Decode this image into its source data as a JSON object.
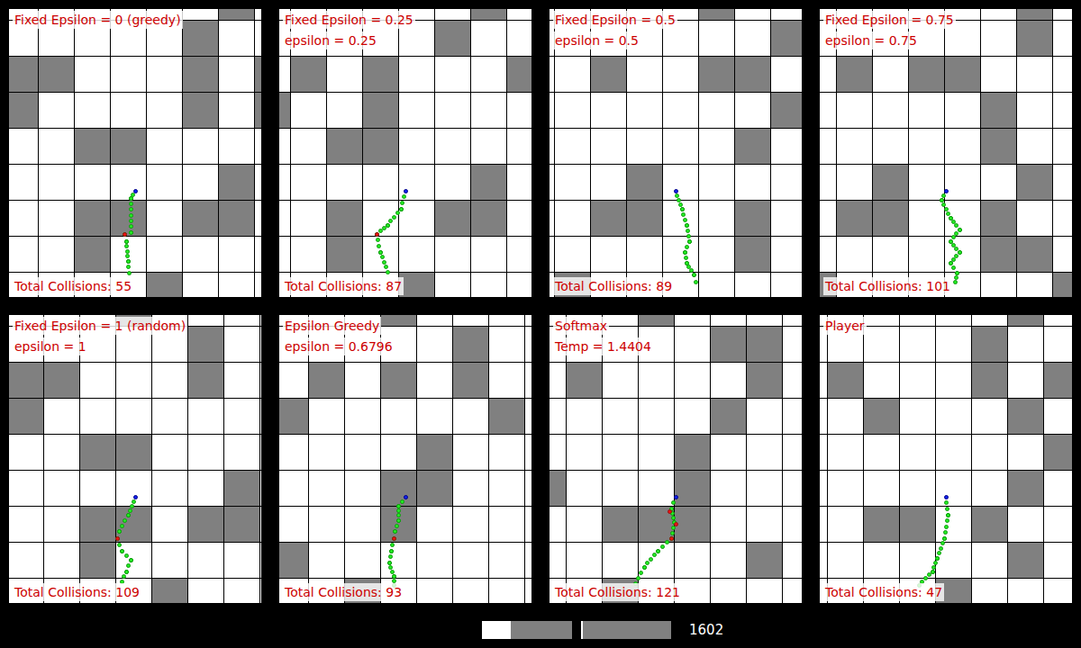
{
  "panels": [
    {
      "title": "Fixed Epsilon = 0 (greedy)",
      "param": null,
      "collisions": "Total Collisions: 55",
      "grid": {
        "offset": [
          -8,
          -28
        ],
        "blocked": [
          [
            6,
            0
          ],
          [
            5,
            1
          ],
          [
            0,
            2
          ],
          [
            1,
            2
          ],
          [
            5,
            2
          ],
          [
            7,
            2
          ],
          [
            0,
            3
          ],
          [
            5,
            3
          ],
          [
            7,
            3
          ],
          [
            2,
            4
          ],
          [
            3,
            4
          ],
          [
            6,
            5
          ],
          [
            2,
            6
          ],
          [
            3,
            6
          ],
          [
            5,
            6
          ],
          [
            6,
            6
          ],
          [
            2,
            7
          ],
          [
            4,
            8
          ]
        ]
      },
      "start": [
        140,
        202
      ],
      "path": [
        [
          140,
          202
        ],
        [
          135,
          210
        ],
        [
          135,
          248
        ],
        [
          128,
          250
        ],
        [
          130,
          258
        ],
        [
          132,
          280
        ],
        [
          133,
          293
        ]
      ],
      "hits": [
        [
          128,
          250
        ]
      ]
    },
    {
      "title": "Fixed Epsilon = 0.25",
      "param": "epsilon = 0.25",
      "collisions": "Total Collisions: 87",
      "grid": {
        "offset": [
          -28,
          -28
        ],
        "blocked": [
          [
            6,
            0
          ],
          [
            5,
            1
          ],
          [
            1,
            2
          ],
          [
            3,
            2
          ],
          [
            7,
            2
          ],
          [
            0,
            3
          ],
          [
            3,
            3
          ],
          [
            2,
            4
          ],
          [
            3,
            4
          ],
          [
            6,
            5
          ],
          [
            2,
            6
          ],
          [
            5,
            6
          ],
          [
            6,
            6
          ],
          [
            2,
            7
          ],
          [
            4,
            8
          ]
        ]
      },
      "start": [
        140,
        202
      ],
      "path": [
        [
          140,
          202
        ],
        [
          135,
          222
        ],
        [
          120,
          240
        ],
        [
          108,
          250
        ],
        [
          112,
          270
        ],
        [
          120,
          292
        ]
      ],
      "hits": [
        [
          108,
          250
        ]
      ]
    },
    {
      "title": "Fixed Epsilon = 0.5",
      "param": "epsilon = 0.5",
      "collisions": "Total Collisions: 89",
      "grid": {
        "offset": [
          -35,
          -28
        ],
        "blocked": [
          [
            5,
            0
          ],
          [
            7,
            1
          ],
          [
            2,
            2
          ],
          [
            5,
            2
          ],
          [
            6,
            2
          ],
          [
            7,
            3
          ],
          [
            6,
            4
          ],
          [
            3,
            5
          ],
          [
            2,
            6
          ],
          [
            3,
            6
          ],
          [
            6,
            6
          ],
          [
            6,
            7
          ],
          [
            1,
            8
          ]
        ]
      },
      "start": [
        140,
        202
      ],
      "path": [
        [
          140,
          202
        ],
        [
          147,
          222
        ],
        [
          152,
          240
        ],
        [
          155,
          258
        ],
        [
          150,
          270
        ],
        [
          152,
          282
        ],
        [
          160,
          295
        ],
        [
          162,
          303
        ]
      ],
      "hits": []
    },
    {
      "title": "Fixed Epsilon = 0.75",
      "param": "epsilon = 0.75",
      "collisions": "Total Collisions: 101",
      "grid": {
        "offset": [
          -22,
          -28
        ],
        "blocked": [
          [
            6,
            0
          ],
          [
            6,
            1
          ],
          [
            1,
            2
          ],
          [
            3,
            2
          ],
          [
            4,
            2
          ],
          [
            5,
            3
          ],
          [
            5,
            4
          ],
          [
            2,
            5
          ],
          [
            6,
            5
          ],
          [
            1,
            6
          ],
          [
            2,
            6
          ],
          [
            5,
            6
          ],
          [
            5,
            7
          ],
          [
            6,
            7
          ],
          [
            0,
            8
          ],
          [
            7,
            8
          ]
        ]
      },
      "start": [
        140,
        202
      ],
      "path": [
        [
          140,
          202
        ],
        [
          135,
          212
        ],
        [
          145,
          232
        ],
        [
          155,
          245
        ],
        [
          145,
          258
        ],
        [
          155,
          270
        ],
        [
          145,
          282
        ],
        [
          152,
          293
        ],
        [
          150,
          303
        ]
      ],
      "hits": []
    },
    {
      "title": "Fixed Epsilon = 1 (random)",
      "param": "epsilon = 1",
      "collisions": "Total Collisions: 109",
      "grid": {
        "offset": [
          -2,
          -28
        ],
        "blocked": [
          [
            3,
            0
          ],
          [
            5,
            1
          ],
          [
            0,
            2
          ],
          [
            1,
            2
          ],
          [
            5,
            2
          ],
          [
            0,
            3
          ],
          [
            2,
            4
          ],
          [
            3,
            4
          ],
          [
            6,
            5
          ],
          [
            2,
            6
          ],
          [
            3,
            6
          ],
          [
            5,
            6
          ],
          [
            6,
            6
          ],
          [
            2,
            7
          ],
          [
            4,
            8
          ]
        ]
      },
      "start": [
        140,
        202
      ],
      "path": [
        [
          140,
          202
        ],
        [
          132,
          222
        ],
        [
          122,
          240
        ],
        [
          120,
          248
        ],
        [
          125,
          262
        ],
        [
          135,
          272
        ],
        [
          130,
          285
        ],
        [
          125,
          296
        ]
      ],
      "hits": [
        [
          120,
          248
        ]
      ]
    },
    {
      "title": "Epsilon Greedy",
      "param": "epsilon = 0.6796",
      "collisions": "Total Collisions: 93",
      "grid": {
        "offset": [
          -8,
          -28
        ],
        "blocked": [
          [
            3,
            0
          ],
          [
            5,
            1
          ],
          [
            1,
            2
          ],
          [
            3,
            2
          ],
          [
            5,
            2
          ],
          [
            0,
            3
          ],
          [
            6,
            3
          ],
          [
            4,
            4
          ],
          [
            3,
            5
          ],
          [
            4,
            5
          ],
          [
            3,
            6
          ],
          [
            0,
            7
          ],
          [
            2,
            8
          ]
        ]
      },
      "start": [
        140,
        202
      ],
      "path": [
        [
          140,
          202
        ],
        [
          132,
          212
        ],
        [
          132,
          228
        ],
        [
          128,
          240
        ],
        [
          127,
          248
        ],
        [
          124,
          262
        ],
        [
          122,
          275
        ],
        [
          127,
          290
        ],
        [
          127,
          300
        ]
      ],
      "hits": [
        [
          127,
          248
        ]
      ]
    },
    {
      "title": "Softmax",
      "param": "Temp = 1.4404",
      "collisions": "Total Collisions: 121",
      "grid": {
        "offset": [
          -22,
          -28
        ],
        "blocked": [
          [
            3,
            0
          ],
          [
            5,
            1
          ],
          [
            6,
            1
          ],
          [
            1,
            2
          ],
          [
            6,
            2
          ],
          [
            5,
            3
          ],
          [
            4,
            4
          ],
          [
            0,
            5
          ],
          [
            4,
            5
          ],
          [
            2,
            6
          ],
          [
            3,
            6
          ],
          [
            4,
            6
          ],
          [
            6,
            7
          ],
          [
            2,
            8
          ]
        ]
      },
      "start": [
        140,
        202
      ],
      "path": [
        [
          140,
          202
        ],
        [
          135,
          215
        ],
        [
          138,
          230
        ],
        [
          135,
          248
        ],
        [
          120,
          262
        ],
        [
          105,
          280
        ],
        [
          95,
          298
        ]
      ],
      "hits": [
        [
          133,
          218
        ],
        [
          140,
          232
        ],
        [
          135,
          248
        ]
      ]
    },
    {
      "title": "Player",
      "param": null,
      "collisions": "Total Collisions: 47",
      "grid": {
        "offset": [
          -32,
          -28
        ],
        "blocked": [
          [
            6,
            0
          ],
          [
            5,
            1
          ],
          [
            1,
            2
          ],
          [
            5,
            2
          ],
          [
            7,
            2
          ],
          [
            2,
            3
          ],
          [
            6,
            3
          ],
          [
            7,
            4
          ],
          [
            6,
            5
          ],
          [
            2,
            6
          ],
          [
            3,
            6
          ],
          [
            5,
            6
          ],
          [
            6,
            7
          ],
          [
            4,
            8
          ]
        ]
      },
      "start": [
        140,
        202
      ],
      "path": [
        [
          140,
          202
        ],
        [
          142,
          222
        ],
        [
          138,
          248
        ],
        [
          130,
          270
        ],
        [
          125,
          285
        ],
        [
          110,
          300
        ]
      ],
      "hits": []
    }
  ],
  "controls": {
    "sliders": [
      {
        "level": 0.32
      },
      {
        "level": 0.0
      }
    ],
    "counter": "1602"
  }
}
